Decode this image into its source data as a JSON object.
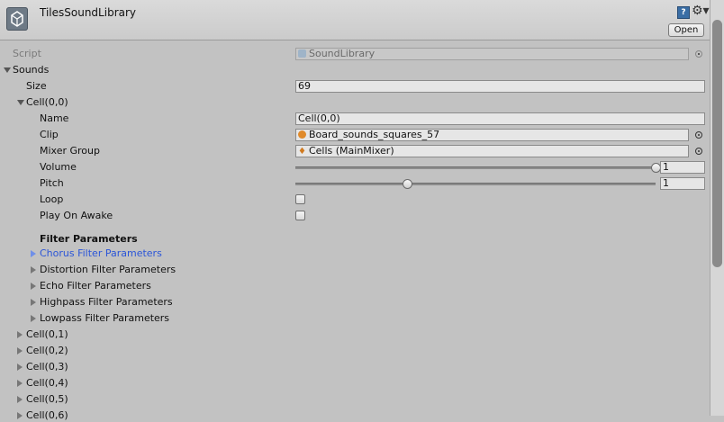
{
  "header": {
    "title": "TilesSoundLibrary",
    "open_label": "Open",
    "help_glyph": "?",
    "gear_glyph": "⚙▾"
  },
  "script_row": {
    "label": "Script",
    "value": "SoundLibrary"
  },
  "sounds": {
    "label": "Sounds",
    "size_label": "Size",
    "size_value": "69",
    "cell0": {
      "label": "Cell(0,0)",
      "name_label": "Name",
      "name_value": "Cell(0,0)",
      "clip_label": "Clip",
      "clip_value": "Board_sounds_squares_57",
      "mixer_label": "Mixer Group",
      "mixer_value": "Cells (MainMixer)",
      "volume_label": "Volume",
      "volume_value": "1",
      "pitch_label": "Pitch",
      "pitch_value": "1",
      "loop_label": "Loop",
      "play_label": "Play On Awake",
      "filter_header": "Filter Parameters",
      "filters": [
        "Chorus Filter Parameters",
        "Distortion Filter Parameters",
        "Echo Filter Parameters",
        "Highpass Filter Parameters",
        "Lowpass Filter Parameters"
      ]
    },
    "cells": [
      "Cell(0,1)",
      "Cell(0,2)",
      "Cell(0,3)",
      "Cell(0,4)",
      "Cell(0,5)",
      "Cell(0,6)"
    ]
  },
  "sliders": {
    "volume_fraction": 1.0,
    "pitch_fraction": 0.31
  },
  "colors": {
    "accent_blue": "#2b55d8",
    "panel_bg": "#c2c2c2"
  }
}
